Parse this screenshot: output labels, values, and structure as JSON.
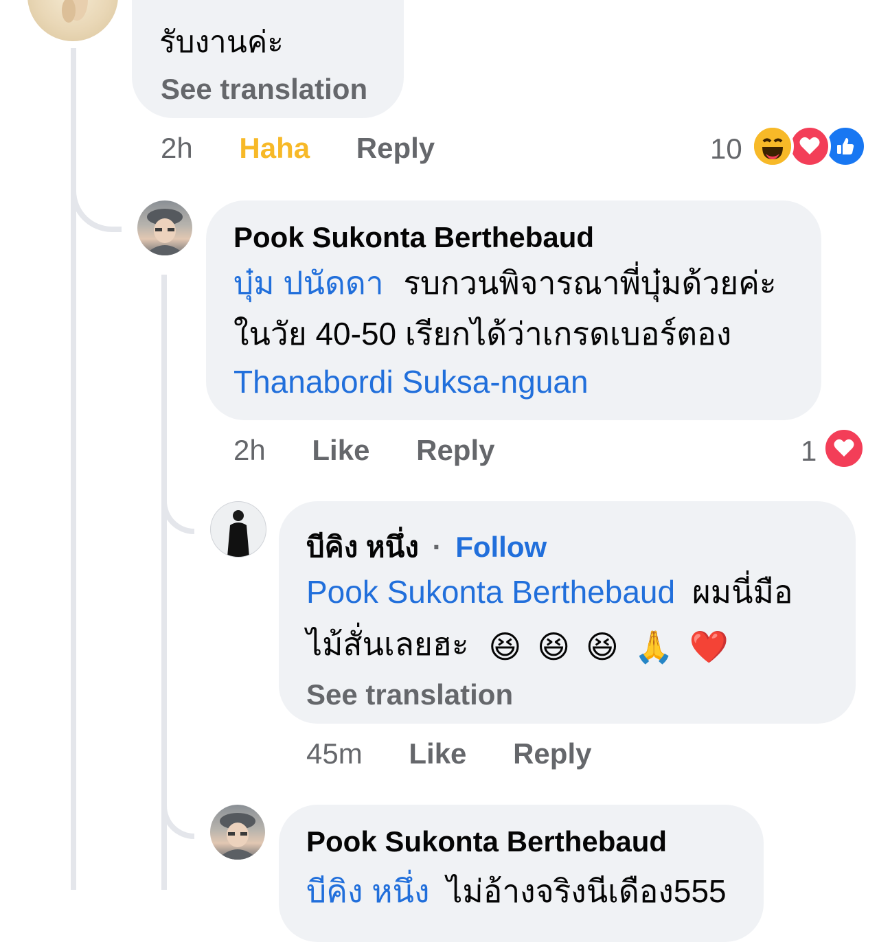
{
  "comment_top": {
    "text": "รับงานค่ะ",
    "see_translation": "See translation",
    "time": "2h",
    "reaction_action": "Haha",
    "reply": "Reply",
    "reaction_count": "10",
    "reactions": [
      "haha-icon",
      "love-icon",
      "like-icon"
    ]
  },
  "reply_1": {
    "author": "Pook Sukonta Berthebaud",
    "mention": "บุ๋ม ปนัดดา",
    "text_line1": "รบกวนพิจารณาพี่บุ๋มด้วยค่ะ",
    "text_line2": "ในวัย 40-50 เรียกได้ว่าเกรดเบอร์ตอง",
    "mention2": "Thanabordi Suksa-nguan",
    "time": "2h",
    "like": "Like",
    "reply": "Reply",
    "reaction_count": "1",
    "reactions": [
      "love-icon"
    ]
  },
  "reply_2": {
    "author": "บีคิง หนึ่ง",
    "separator": "·",
    "follow": "Follow",
    "mention": "Pook Sukonta Berthebaud",
    "text_line1": "ผมนี่มือ",
    "text_line2": "ไม้สั่นเลยฮะ",
    "emojis": [
      "😆",
      "😆",
      "😆",
      "🙏",
      "❤️"
    ],
    "see_translation": "See translation",
    "time": "45m",
    "like": "Like",
    "reply": "Reply"
  },
  "reply_3": {
    "author": "Pook Sukonta Berthebaud",
    "mention": "บีคิง หนึ่ง",
    "text": "ไม่อ้างจริงนีเดือง555"
  },
  "colors": {
    "mention": "#216fdb",
    "haha": "#f7b928",
    "bubble": "#f0f2f5",
    "muted": "#65676b",
    "love": "#f33e58",
    "like": "#1877f2"
  }
}
